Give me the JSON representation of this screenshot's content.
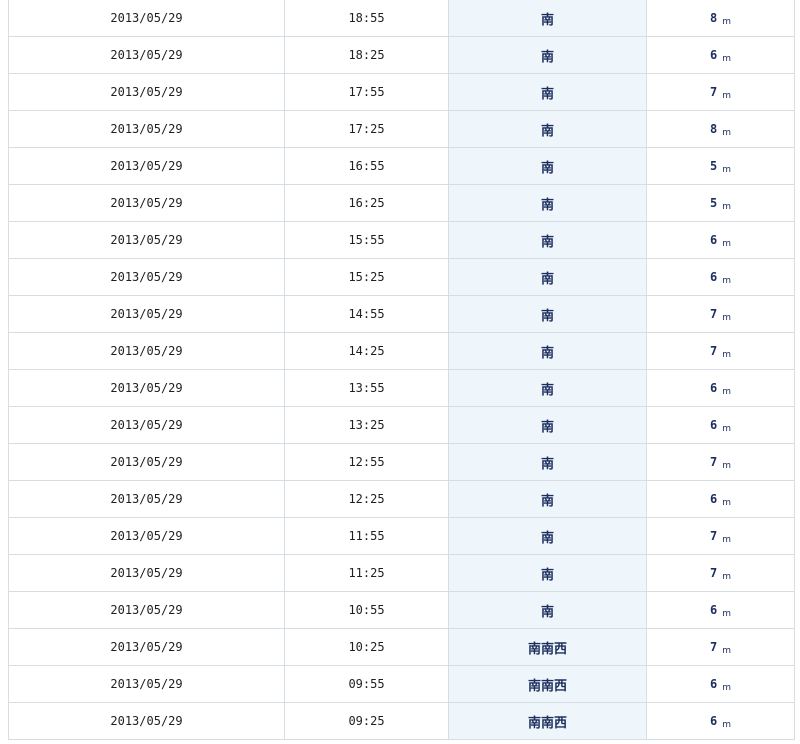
{
  "columns": [
    "date",
    "time",
    "direction",
    "height"
  ],
  "height_unit": "m",
  "colors": {
    "direction_bg": "#eef5fb",
    "accent_text": "#1c2e5e",
    "grid_line": "#d6dde3"
  },
  "rows": [
    {
      "date": "2013/05/29",
      "time": "18:55",
      "direction": "南",
      "height": "8"
    },
    {
      "date": "2013/05/29",
      "time": "18:25",
      "direction": "南",
      "height": "6"
    },
    {
      "date": "2013/05/29",
      "time": "17:55",
      "direction": "南",
      "height": "7"
    },
    {
      "date": "2013/05/29",
      "time": "17:25",
      "direction": "南",
      "height": "8"
    },
    {
      "date": "2013/05/29",
      "time": "16:55",
      "direction": "南",
      "height": "5"
    },
    {
      "date": "2013/05/29",
      "time": "16:25",
      "direction": "南",
      "height": "5"
    },
    {
      "date": "2013/05/29",
      "time": "15:55",
      "direction": "南",
      "height": "6"
    },
    {
      "date": "2013/05/29",
      "time": "15:25",
      "direction": "南",
      "height": "6"
    },
    {
      "date": "2013/05/29",
      "time": "14:55",
      "direction": "南",
      "height": "7"
    },
    {
      "date": "2013/05/29",
      "time": "14:25",
      "direction": "南",
      "height": "7"
    },
    {
      "date": "2013/05/29",
      "time": "13:55",
      "direction": "南",
      "height": "6"
    },
    {
      "date": "2013/05/29",
      "time": "13:25",
      "direction": "南",
      "height": "6"
    },
    {
      "date": "2013/05/29",
      "time": "12:55",
      "direction": "南",
      "height": "7"
    },
    {
      "date": "2013/05/29",
      "time": "12:25",
      "direction": "南",
      "height": "6"
    },
    {
      "date": "2013/05/29",
      "time": "11:55",
      "direction": "南",
      "height": "7"
    },
    {
      "date": "2013/05/29",
      "time": "11:25",
      "direction": "南",
      "height": "7"
    },
    {
      "date": "2013/05/29",
      "time": "10:55",
      "direction": "南",
      "height": "6"
    },
    {
      "date": "2013/05/29",
      "time": "10:25",
      "direction": "南南西",
      "height": "7"
    },
    {
      "date": "2013/05/29",
      "time": "09:55",
      "direction": "南南西",
      "height": "6"
    },
    {
      "date": "2013/05/29",
      "time": "09:25",
      "direction": "南南西",
      "height": "6"
    }
  ]
}
